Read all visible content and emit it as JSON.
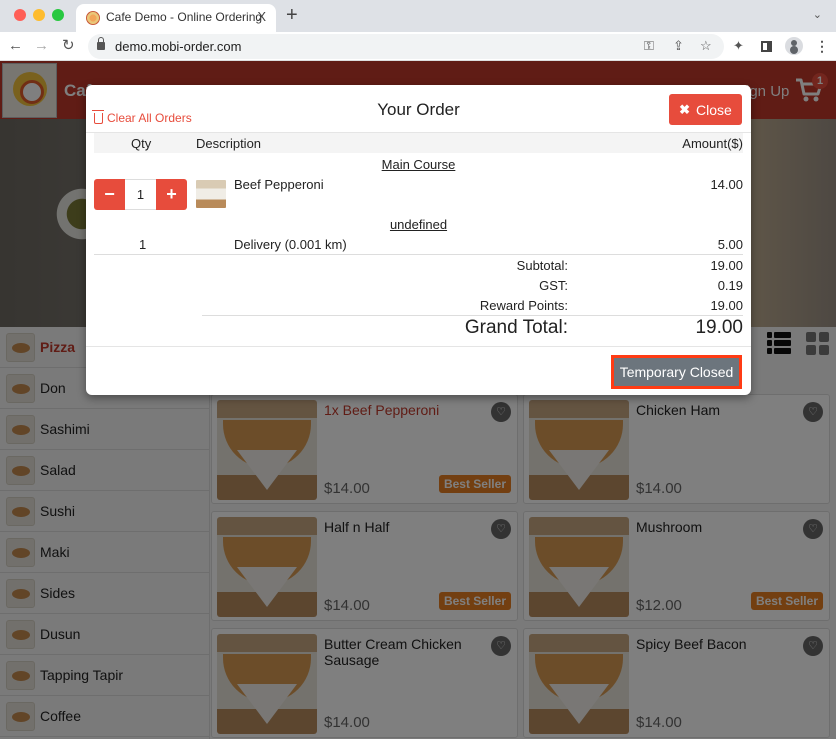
{
  "browser": {
    "tab_title": "Cafe Demo - Online Ordering",
    "tab_close": "X",
    "new_tab": "+",
    "tab_menu": "⌄",
    "url": "demo.mobi-order.com",
    "nav": {
      "back": "←",
      "forward": "→",
      "reload": "↻"
    },
    "icons": {
      "key": "⚿",
      "share": "⇪",
      "star": "☆",
      "extensions": "✦",
      "menu": "⋮"
    }
  },
  "site": {
    "name": "Cafe",
    "signup_label": "Sign Up",
    "cart_count": "1",
    "colors": {
      "brand": "#c0392b",
      "accent": "#e74c3c",
      "best_seller": "#e67e22"
    }
  },
  "categories": [
    {
      "label": "Pizza",
      "active": true
    },
    {
      "label": "Don"
    },
    {
      "label": "Sashimi"
    },
    {
      "label": "Salad"
    },
    {
      "label": "Sushi"
    },
    {
      "label": "Maki"
    },
    {
      "label": "Sides"
    },
    {
      "label": "Dusun"
    },
    {
      "label": "Tapping Tapir"
    },
    {
      "label": "Coffee"
    }
  ],
  "products": [
    {
      "name": "1x Beef Pepperoni",
      "price": "$14.00",
      "badge": "Best Seller",
      "in_cart": true
    },
    {
      "name": "Chicken Ham",
      "price": "$14.00",
      "badge": ""
    },
    {
      "name": "Half n Half",
      "price": "$14.00",
      "badge": "Best Seller"
    },
    {
      "name": "Mushroom",
      "price": "$12.00",
      "badge": "Best Seller"
    },
    {
      "name": "Butter Cream Chicken Sausage",
      "price": "$14.00",
      "badge": ""
    },
    {
      "name": "Spicy Beef Bacon",
      "price": "$14.00",
      "badge": ""
    }
  ],
  "modal": {
    "title": "Your Order",
    "clear_label": "Clear All Orders",
    "close_label": "Close",
    "close_icon": "✖",
    "columns": {
      "qty": "Qty",
      "description": "Description",
      "amount": "Amount($)"
    },
    "groups": [
      {
        "title": "Main Course",
        "items": [
          {
            "qty": "1",
            "description": "Beef Pepperoni",
            "amount": "14.00"
          }
        ]
      },
      {
        "title": "undefined",
        "items": [
          {
            "qty": "1",
            "description": "Delivery (0.001 km)",
            "amount": "5.00"
          }
        ]
      }
    ],
    "qty_minus": "−",
    "qty_plus": "+",
    "summary": {
      "subtotal_label": "Subtotal:",
      "subtotal": "19.00",
      "gst_label": "GST:",
      "gst": "0.19",
      "reward_label": "Reward Points:",
      "reward": "19.00",
      "grand_label": "Grand Total:",
      "grand": "19.00"
    },
    "action_label": "Temporary Closed"
  }
}
